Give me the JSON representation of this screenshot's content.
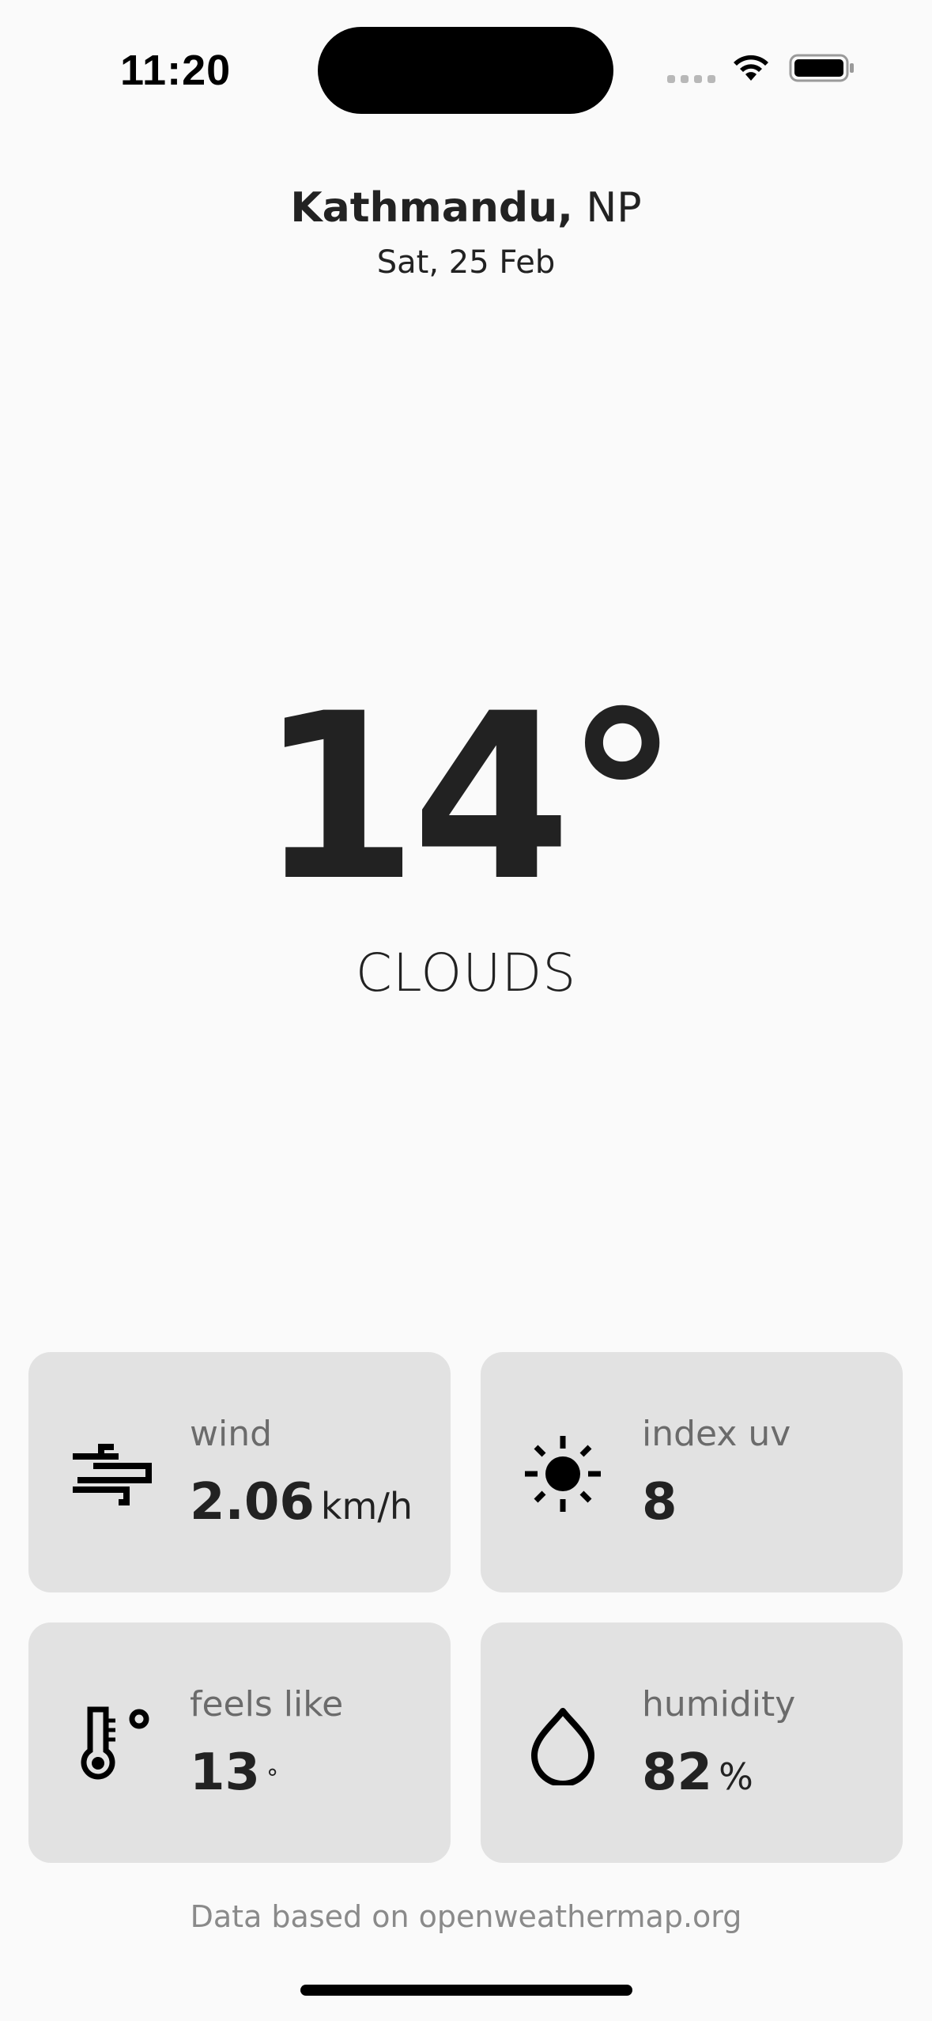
{
  "status_bar": {
    "time": "11:20"
  },
  "location": {
    "city": "Kathmandu,",
    "country": "NP",
    "date": "Sat, 25 Feb"
  },
  "weather": {
    "temperature": "14°",
    "condition": "CLOUDS"
  },
  "cards": {
    "wind": {
      "label": "wind",
      "value": "2.06",
      "unit": "km/h",
      "icon": "wind-icon"
    },
    "uv": {
      "label": "index uv",
      "value": "8",
      "icon": "sun-icon"
    },
    "feels_like": {
      "label": "feels like",
      "value": "13",
      "unit": "°",
      "icon": "thermometer-icon"
    },
    "humidity": {
      "label": "humidity",
      "value": "82",
      "unit": "%",
      "icon": "droplet-icon"
    }
  },
  "footer": {
    "text": "Data based on openweathermap.org"
  },
  "colors": {
    "background": "#fafafa",
    "card": "#e2e2e2",
    "text": "#222222",
    "muted": "#6b6b6b"
  }
}
